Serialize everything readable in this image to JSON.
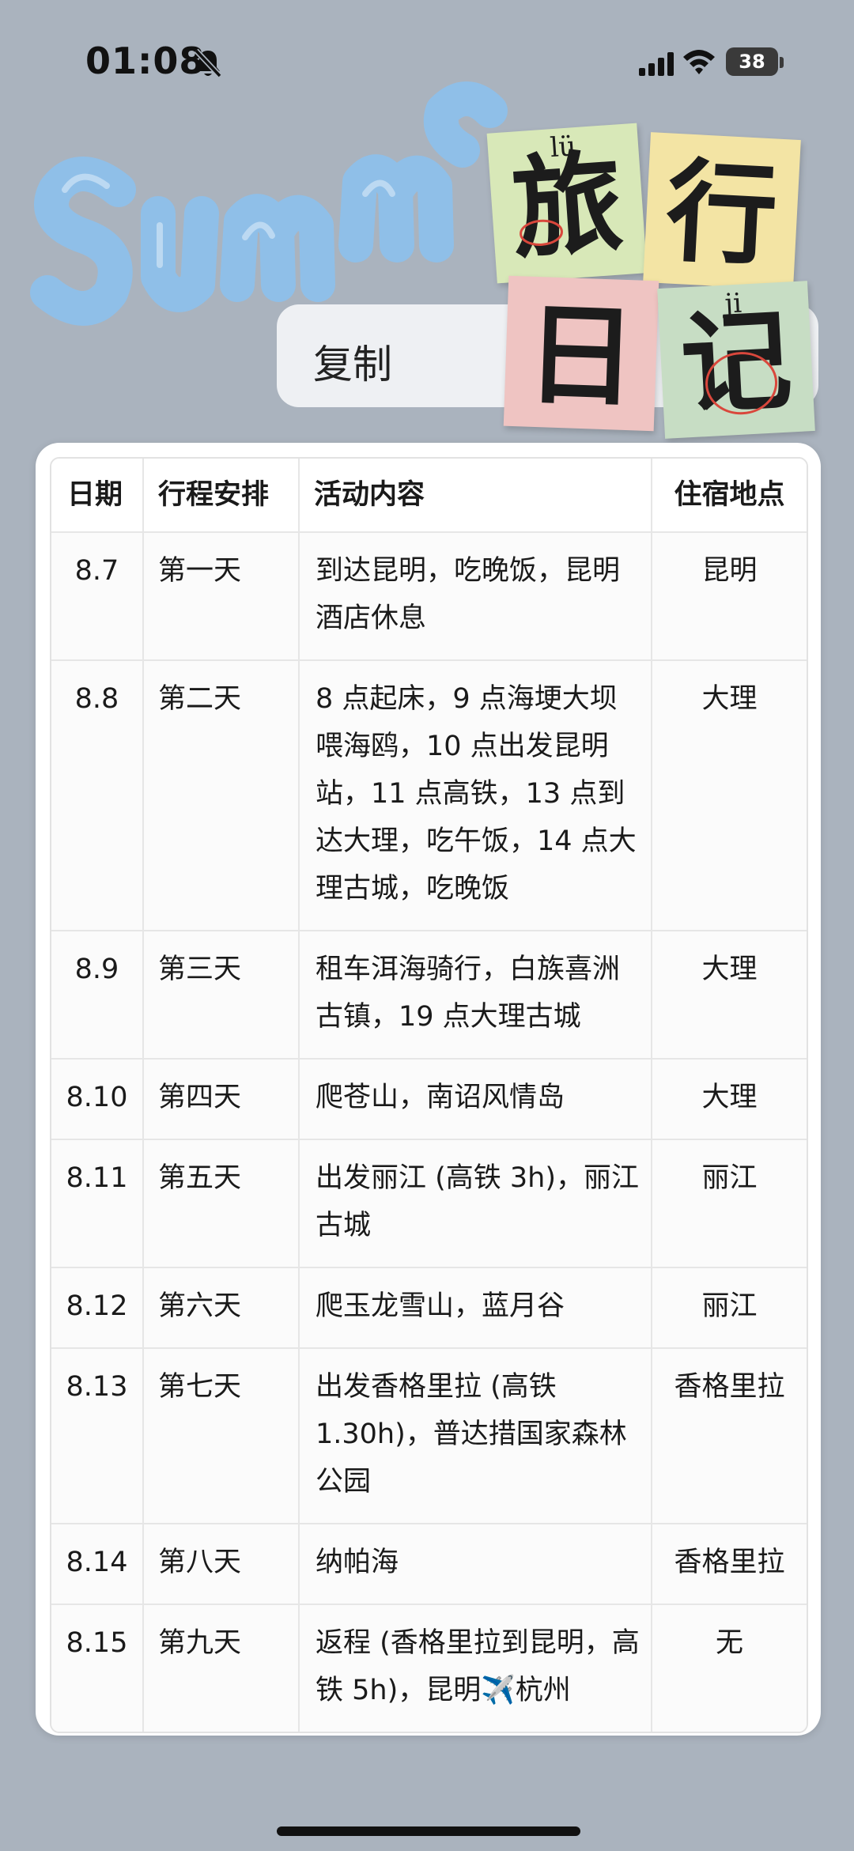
{
  "status_bar": {
    "time": "01:08",
    "battery": "38",
    "icons": [
      "bell-slash-icon",
      "cellular-signal-icon",
      "wifi-icon",
      "battery-icon"
    ]
  },
  "sticker": {
    "diary": {
      "lu": {
        "char": "旅",
        "pinyin": "lü"
      },
      "xing": {
        "char": "行"
      },
      "ri": {
        "char": "日"
      },
      "ji": {
        "char": "记",
        "pinyin": "ji"
      }
    },
    "colors": {
      "summer_blue": "#8fbfe8",
      "lu_bg": "#d8e8b8",
      "xing_bg": "#f3e4a4",
      "ri_bg": "#efc4c2",
      "ji_bg": "#c7ddc4",
      "accent_red": "#d9473c"
    }
  },
  "context_menu": {
    "copy": "复制"
  },
  "table": {
    "headers": {
      "date": "日期",
      "day": "行程安排",
      "activity": "活动内容",
      "stay": "住宿地点"
    },
    "rows": [
      {
        "date": "8.7",
        "day": "第一天",
        "activity": "到达昆明，吃晚饭，昆明酒店休息",
        "stay": "昆明"
      },
      {
        "date": "8.8",
        "day": "第二天",
        "activity": "8 点起床，9 点海埂大坝喂海鸥，10 点出发昆明站，11 点高铁，13 点到达大理，吃午饭，14 点大理古城，吃晚饭",
        "stay": "大理"
      },
      {
        "date": "8.9",
        "day": "第三天",
        "activity": "租车洱海骑行，白族喜洲古镇，19 点大理古城",
        "stay": "大理"
      },
      {
        "date": "8.10",
        "day": "第四天",
        "activity": "爬苍山，南诏风情岛",
        "stay": "大理"
      },
      {
        "date": "8.11",
        "day": "第五天",
        "activity": "出发丽江 (高铁 3h)，丽江古城",
        "stay": "丽江"
      },
      {
        "date": "8.12",
        "day": "第六天",
        "activity": "爬玉龙雪山，蓝月谷",
        "stay": "丽江"
      },
      {
        "date": "8.13",
        "day": "第七天",
        "activity": "出发香格里拉 (高铁 1.30h)，普达措国家森林公园",
        "stay": "香格里拉"
      },
      {
        "date": "8.14",
        "day": "第八天",
        "activity": "纳帕海",
        "stay": "香格里拉"
      },
      {
        "date": "8.15",
        "day": "第九天",
        "activity": "返程 (香格里拉到昆明，高铁 5h)，昆明✈️杭州",
        "stay": "无"
      }
    ]
  }
}
